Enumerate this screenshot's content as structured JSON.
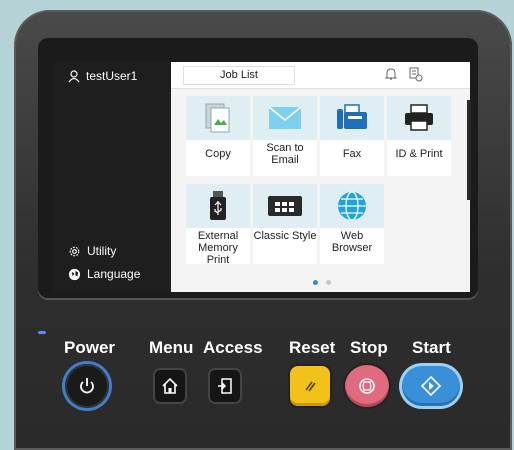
{
  "sidebar": {
    "user_label": "testUser1",
    "user_icon": "user-icon",
    "items": [
      {
        "label": "Utility",
        "icon": "gear-icon"
      },
      {
        "label": "Language",
        "icon": "globe-icon"
      }
    ]
  },
  "topbar": {
    "job_list_label": "Job List",
    "bell_icon": "bell-icon",
    "server_icon": "server-status-icon"
  },
  "tiles": [
    {
      "label": "Copy",
      "icon": "copy-icon"
    },
    {
      "label": "Scan to Email",
      "icon": "email-icon"
    },
    {
      "label": "Fax",
      "icon": "fax-icon"
    },
    {
      "label": "ID & Print",
      "icon": "printer-icon"
    },
    {
      "label": "External Memory Print",
      "icon": "usb-icon"
    },
    {
      "label": "Classic Style",
      "icon": "keyboard-icon"
    },
    {
      "label": "Web Browser",
      "icon": "globe-icon"
    }
  ],
  "pager": {
    "pages": 2,
    "current": 1
  },
  "hardware_buttons": {
    "power": "Power",
    "menu": "Menu",
    "access": "Access",
    "reset": "Reset",
    "stop": "Stop",
    "start": "Start"
  },
  "colors": {
    "accent": "#2a8fd0",
    "reset": "#f2c21a",
    "stop": "#e06a7e",
    "start": "#3a90d8"
  }
}
